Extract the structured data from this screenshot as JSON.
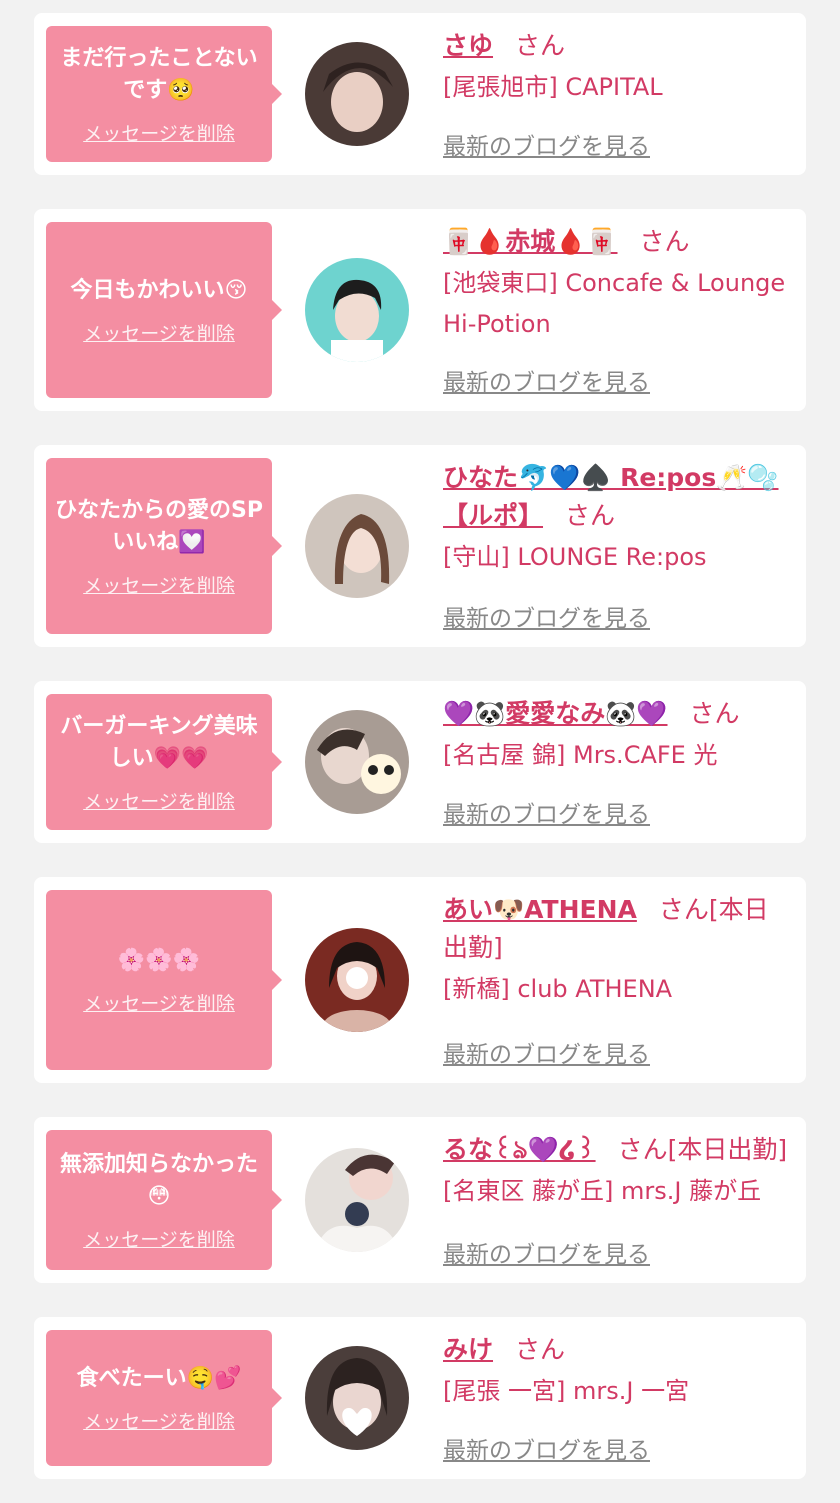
{
  "cards": [
    {
      "message": "まだ行ったことないです🥺",
      "delete": "メッセージを削除",
      "name": "さゆ",
      "suffix": "さん",
      "location": "[尾張旭市] CAPITAL",
      "blog": "最新のブログを見る"
    },
    {
      "message": "今日もかわいい😚",
      "delete": "メッセージを削除",
      "name": "🀄🩸赤城🩸🀄",
      "suffix": "さん",
      "location": "[池袋東口] Concafe & Lounge Hi-Potion",
      "blog": "最新のブログを見る"
    },
    {
      "message": "ひなたからの愛のSPいいね💟",
      "delete": "メッセージを削除",
      "name": "ひなた🐬💙♠️ Re:pos🥂🫧【ルポ】",
      "suffix": "さん",
      "location": "[守山] LOUNGE Re:pos",
      "blog": "最新のブログを見る"
    },
    {
      "message": "バーガーキング美味しい💗💗",
      "delete": "メッセージを削除",
      "name": "💜🐼愛愛なみ🐼💜",
      "suffix": "さん",
      "location": "[名古屋 錦] Mrs.CAFE 光",
      "blog": "最新のブログを見る"
    },
    {
      "message": "🌸🌸🌸",
      "delete": "メッセージを削除",
      "name": "あい🐶ATHENA",
      "suffix": "さん[本日出勤]",
      "location": "[新橋] club ATHENA",
      "blog": "最新のブログを見る"
    },
    {
      "message": "無添加知らなかった😳",
      "delete": "メッセージを削除",
      "name": "るな꒰ঌ💜໒꒱",
      "suffix": "さん[本日出勤]",
      "location": "[名東区 藤が丘] mrs.J 藤が丘",
      "blog": "最新のブログを見る"
    },
    {
      "message": "食べたーい🤤💕",
      "delete": "メッセージを削除",
      "name": "みけ",
      "suffix": "さん",
      "location": "[尾張 一宮] mrs.J 一宮",
      "blog": "最新のブログを見る"
    }
  ],
  "colors": {
    "bubble": "#f48ea2",
    "name": "#d23a64",
    "link_gray": "#888888",
    "background": "#f2f2f2"
  }
}
